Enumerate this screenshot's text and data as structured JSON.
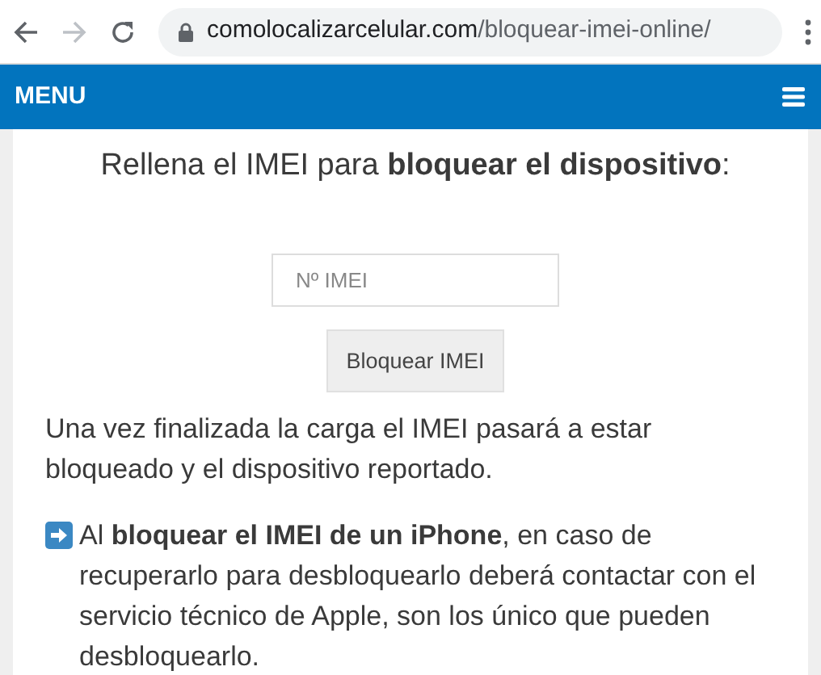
{
  "browser": {
    "url_domain": "comolocalizarcelular.com",
    "url_path": "/bloquear-imei-online/"
  },
  "nav": {
    "title": "MENU"
  },
  "heading": "Rellena el IMEI para **bloquear el dispositivo**:",
  "imei_field": {
    "placeholder": "Nº IMEI"
  },
  "submit_button": "Bloquear IMEI",
  "paragraphs": [
    {
      "kind": "plain",
      "text": "Una vez finalizada la carga el IMEI pasará a estar bloqueado y el dispositivo reportado."
    },
    {
      "kind": "arrow",
      "text": "Al **bloquear el IMEI de un iPhone**, en caso de recuperarlo para desbloquearlo deberá contactar con el servicio técnico de Apple, son los único que pueden desbloquearlo."
    }
  ]
}
